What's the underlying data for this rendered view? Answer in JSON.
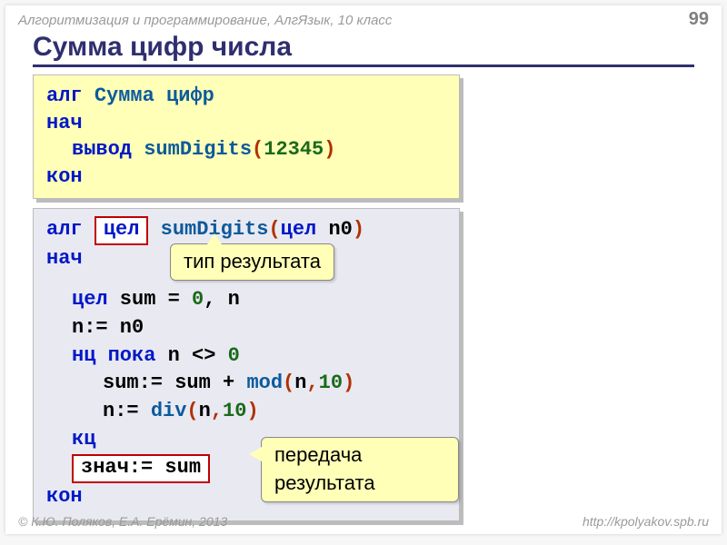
{
  "header": {
    "course": "Алгоритмизация и программирование, АлгЯзык, 10 класс",
    "page": "99"
  },
  "title": "Сумма цифр числа",
  "box1": {
    "l1_alg": "алг",
    "l1_name": "Сумма цифр",
    "l2_nach": "нач",
    "l3_vyvod": "вывод",
    "l3_fn": "sumDigits",
    "l3_open": "(",
    "l3_num": "12345",
    "l3_close": ")",
    "l4_kon": "кон"
  },
  "box2": {
    "l1_alg": "алг",
    "chip_cel": "цел",
    "l1_fn": "sumDigits",
    "l1_open": "(",
    "l1_cel": "цел",
    "l1_arg": " n0",
    "l1_close": ")",
    "l2_nach": "нач",
    "callout1": "тип результата",
    "l3_cel": "цел",
    "l3_rest": " sum = ",
    "l3_zero": "0",
    "l3_tail": ",  n",
    "l4": "n:= n0",
    "l5_nc": "нц",
    "l5_poka": " пока",
    "l5_tail": "  n <> ",
    "l5_zero": "0",
    "l6_head": "sum:= sum + ",
    "l6_mod": "mod",
    "l6_open": "(",
    "l6_n": "n",
    "l6_comma": ",",
    "l6_ten": "10",
    "l6_close": ")",
    "l7_head": "n:= ",
    "l7_div": "div",
    "l7_open": "(",
    "l7_n": "n",
    "l7_comma": ",",
    "l7_ten": "10",
    "l7_close": ")",
    "l8_kc": "кц",
    "chip_znach": "знач:= sum",
    "callout2": "передача результата",
    "l10_kon": "кон"
  },
  "footer": {
    "left": "© К.Ю. Поляков, Е.А. Ерёмин, 2013",
    "right": "http://kpolyakov.spb.ru"
  }
}
